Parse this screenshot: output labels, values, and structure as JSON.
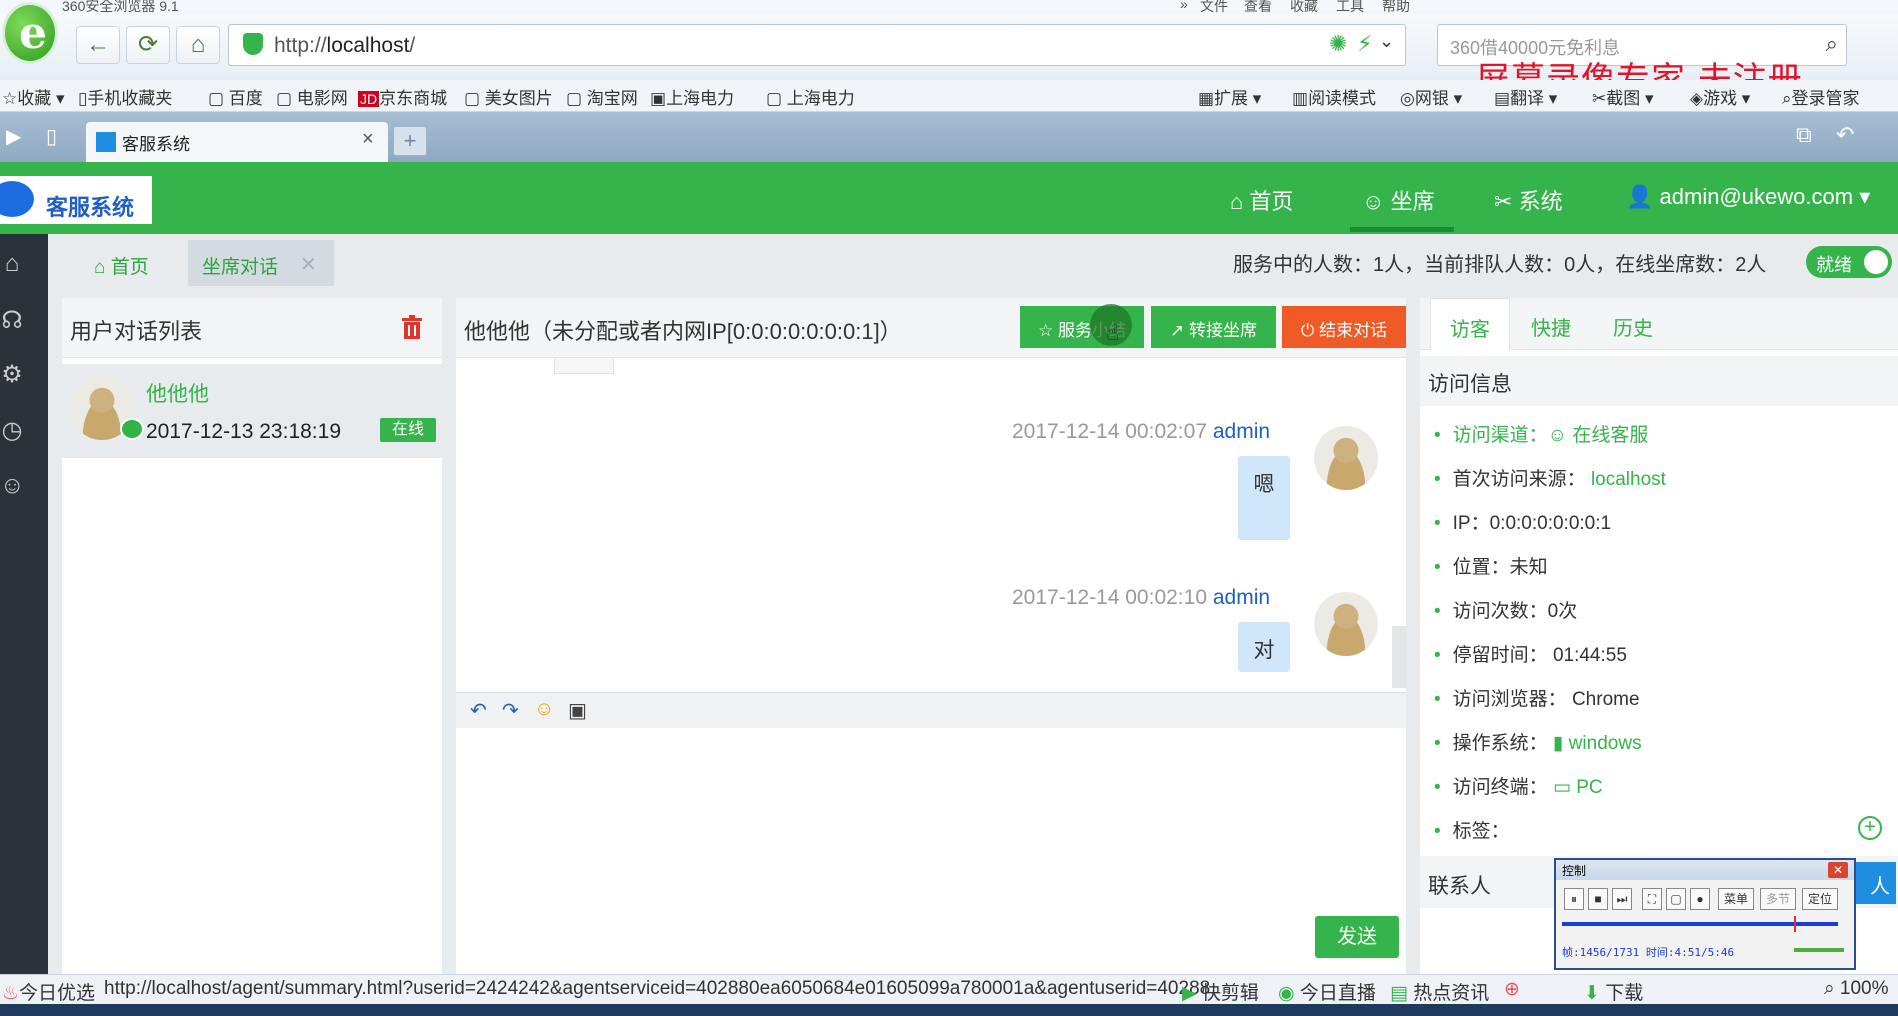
{
  "browser": {
    "title": "360安全浏览器 9.1",
    "url_prefix": "http://",
    "url_host": "localhost",
    "url_path": "/",
    "search_placeholder": "360借40000元免利息",
    "watermark": "屏幕录像专家  未注册",
    "menu": [
      "»",
      "文件",
      "查看",
      "收藏",
      "工具",
      "帮助"
    ],
    "bookmarks": [
      "收藏",
      "手机收藏夹",
      "百度",
      "电影网",
      "京东商城",
      "美女图片",
      "淘宝网",
      "上海电力",
      "上海电力"
    ],
    "extensions": [
      "扩展",
      "阅读模式",
      "网银",
      "翻译",
      "截图",
      "游戏",
      "登录管家"
    ],
    "tab_title": "客服系统",
    "tab_close": "×",
    "new_tab": "+"
  },
  "app": {
    "logo_text": "客服系统",
    "nav": [
      {
        "label": "首页",
        "icon": "home-icon"
      },
      {
        "label": "坐席",
        "icon": "agent-icon"
      },
      {
        "label": "系统",
        "icon": "tools-icon"
      },
      {
        "label": "admin@ukewo.com",
        "icon": "user-icon"
      }
    ],
    "breadcrumbs": {
      "home": "首页",
      "current": "坐席对话",
      "close": "✕"
    },
    "stats": "服务中的人数：1人，当前排队人数：0人，在线坐席数：2人",
    "ready_label": "就绪"
  },
  "user_list": {
    "title": "用户对话列表",
    "users": [
      {
        "name": "他他他",
        "time": "2017-12-13 23:18:19",
        "status": "在线"
      }
    ]
  },
  "chat": {
    "title": "他他他（未分配或者内网IP[0:0:0:0:0:0:0:1]）",
    "buttons": {
      "service": "服务小结",
      "transfer": "转接坐席",
      "end": "结束对话"
    },
    "messages": [
      {
        "time": "2017-12-14 00:02:07",
        "sender": "admin",
        "text": "嗯"
      },
      {
        "time": "2017-12-14 00:02:10",
        "sender": "admin",
        "text": "对"
      }
    ],
    "send_label": "发送",
    "tools": [
      "undo-icon",
      "redo-icon",
      "emoji-icon",
      "image-icon"
    ]
  },
  "info": {
    "tabs": [
      "访客",
      "快捷",
      "历史"
    ],
    "section_title": "访问信息",
    "items": [
      {
        "label": "访问渠道：",
        "value": "在线客服"
      },
      {
        "label": "首次访问来源：",
        "value": "localhost"
      },
      {
        "label": "IP：",
        "value": "0:0:0:0:0:0:0:1"
      },
      {
        "label": "位置：",
        "value": "未知"
      },
      {
        "label": "访问次数：",
        "value": "0次"
      },
      {
        "label": "停留时间：",
        "value": "01:44:55"
      },
      {
        "label": "访问浏览器：",
        "value": "Chrome"
      },
      {
        "label": "操作系统：",
        "value": "windows"
      },
      {
        "label": "访问终端：",
        "value": "PC"
      },
      {
        "label": "标签：",
        "value": ""
      }
    ],
    "contacts_title": "联系人",
    "contacts_button": "人"
  },
  "recorder": {
    "title": "控制",
    "menu_label": "菜单",
    "multi_label": "多节",
    "locate_label": "定位",
    "progress_text": "帧:1456/1731 时间:4:51/5:46",
    "progress": 0.84
  },
  "status_bar": {
    "left": "今日优选",
    "link": "http://localhost/agent/summary.html?userid=2424242&agentserviceid=402880ea6050684e01605099a780001a&agentuserid=40288",
    "items": [
      "快剪辑",
      "今日直播",
      "热点资讯",
      "下载",
      "100%"
    ]
  },
  "colors": {
    "primary": "#34b44a",
    "danger": "#f05a26",
    "link": "#1f5fc4",
    "rail": "#2d3238"
  }
}
